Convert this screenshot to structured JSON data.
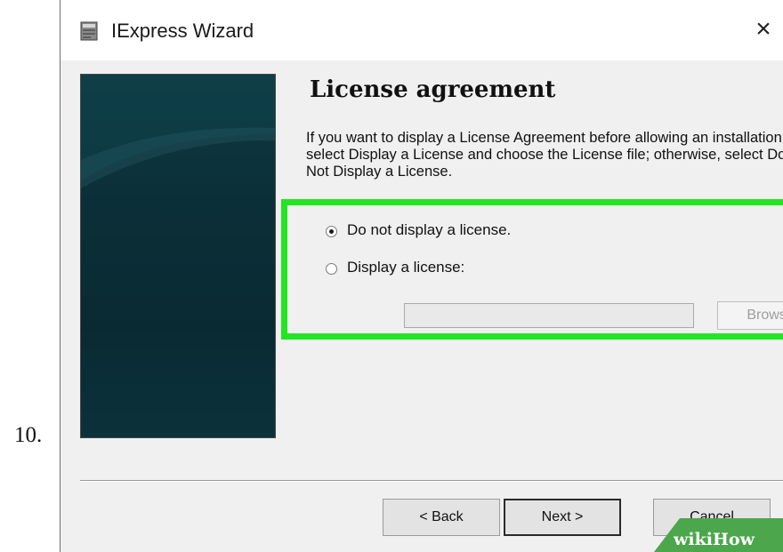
{
  "step": {
    "number": "10."
  },
  "window": {
    "title": "IExpress Wizard",
    "close_glyph": "×"
  },
  "page": {
    "heading": "License agreement",
    "description": "If you want to display a License Agreement before allowing an installation, select Display a License and choose the License file; otherwise, select Do Not Display a License."
  },
  "options": [
    {
      "label": "Do not display a license.",
      "selected": true
    },
    {
      "label": "Display a license:",
      "selected": false
    }
  ],
  "license_file": {
    "value": "",
    "enabled": false
  },
  "browse_button": {
    "label": "Browse",
    "enabled": false
  },
  "buttons": {
    "back": "< Back",
    "next": "Next >",
    "cancel": "Cancel"
  },
  "watermark": {
    "text": "wikiHow"
  },
  "colors": {
    "highlight": "#22e622",
    "banner": "#0b2f38",
    "dialog_background": "#f0f0f0",
    "watermark": "#4ca64c"
  },
  "icons": {
    "app": "installer-icon",
    "close": "close-icon"
  }
}
